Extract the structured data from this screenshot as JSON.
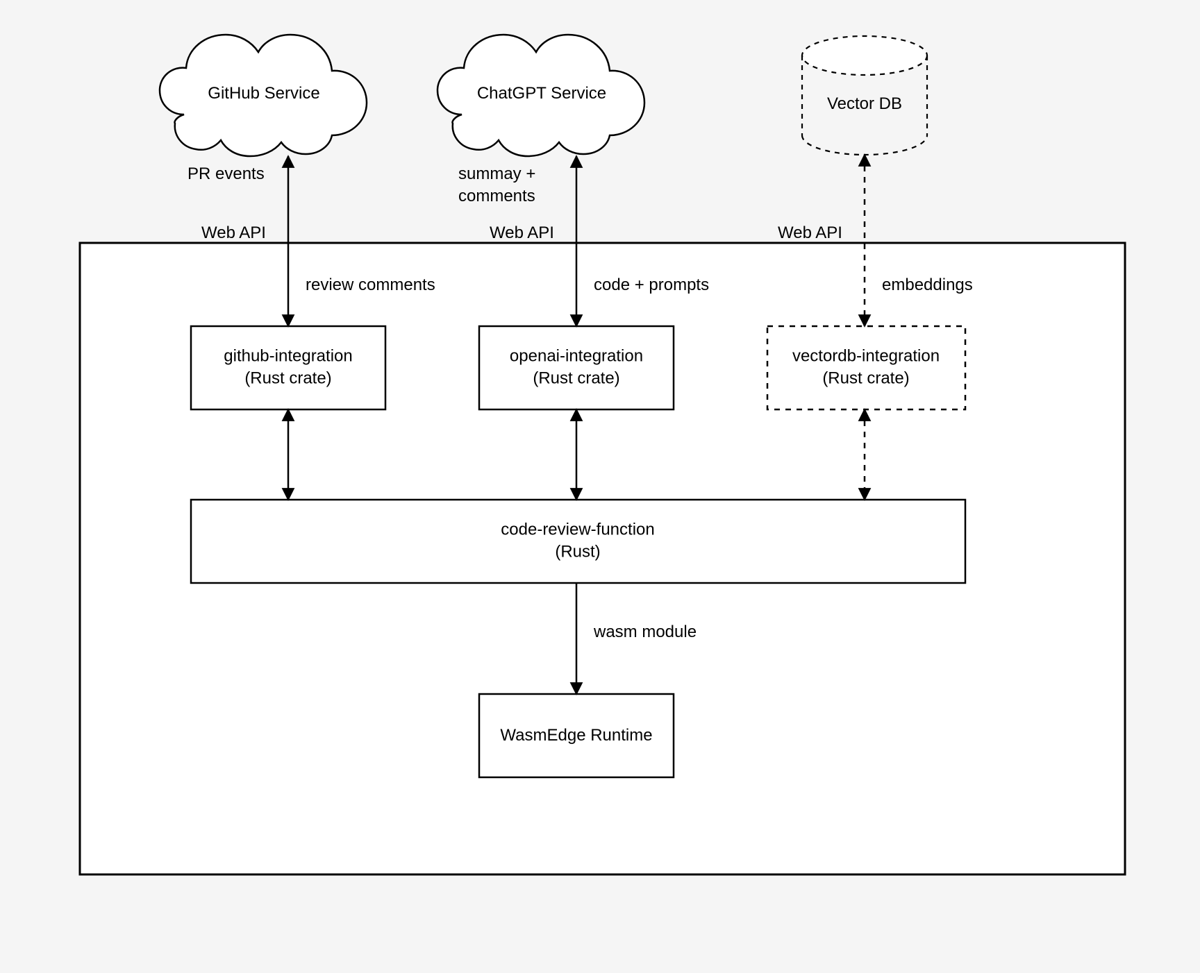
{
  "services": {
    "github": "GitHub Service",
    "chatgpt": "ChatGPT Service",
    "vectordb": "Vector DB"
  },
  "crates": {
    "github_line1": "github-integration",
    "github_line2": "(Rust crate)",
    "openai_line1": "openai-integration",
    "openai_line2": "(Rust crate)",
    "vectordb_line1": "vectordb-integration",
    "vectordb_line2": "(Rust crate)"
  },
  "core": {
    "review_line1": "code-review-function",
    "review_line2": "(Rust)",
    "runtime": "WasmEdge Runtime"
  },
  "labels": {
    "pr_events": "PR events",
    "summary_line1": "summay +",
    "summary_line2": "comments",
    "web_api_1": "Web API",
    "web_api_2": "Web API",
    "web_api_3": "Web API",
    "review_comments": "review comments",
    "code_prompts": "code + prompts",
    "embeddings": "embeddings",
    "wasm_module": "wasm module"
  }
}
